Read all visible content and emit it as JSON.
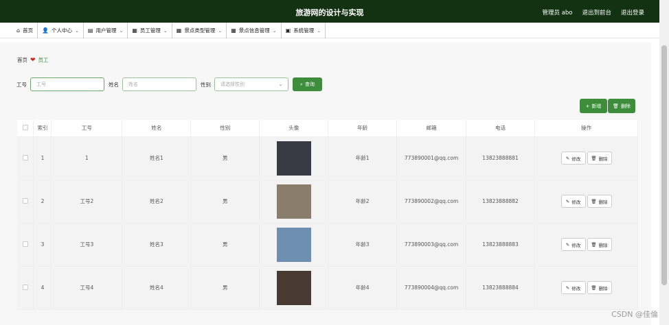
{
  "header": {
    "title": "旅游网的设计与实现",
    "admin": "管理员 abo",
    "exit_front": "退出到前台",
    "logout": "退出登录"
  },
  "nav": [
    {
      "icon": "home-icon",
      "glyph": "⌂",
      "label": "首页",
      "chevron": false
    },
    {
      "icon": "user-icon",
      "glyph": "👤",
      "label": "个人中心",
      "chevron": true
    },
    {
      "icon": "clipboard-icon",
      "glyph": "▤",
      "label": "用户管理",
      "chevron": true
    },
    {
      "icon": "grid-icon",
      "glyph": "▦",
      "label": "员工管理",
      "chevron": true
    },
    {
      "icon": "grid-icon",
      "glyph": "▦",
      "label": "景点类型管理",
      "chevron": true
    },
    {
      "icon": "grid-icon",
      "glyph": "▦",
      "label": "景点信息管理",
      "chevron": true
    },
    {
      "icon": "briefcase-icon",
      "glyph": "▣",
      "label": "系统管理",
      "chevron": true
    }
  ],
  "breadcrumb": {
    "home": "首页",
    "current": "员工"
  },
  "search": {
    "id_label": "工号",
    "id_placeholder": "工号",
    "name_label": "姓名",
    "name_placeholder": "姓名",
    "gender_label": "性别",
    "gender_placeholder": "请选择性别",
    "query_button": "查询"
  },
  "actions": {
    "add": "新增",
    "delete": "删除"
  },
  "table": {
    "columns": [
      "索引",
      "工号",
      "姓名",
      "性别",
      "头像",
      "年龄",
      "邮箱",
      "电话",
      "操作"
    ],
    "rows": [
      {
        "index": "1",
        "id": "1",
        "name": "姓名1",
        "gender": "男",
        "age": "年龄1",
        "email": "773890001@qq.com",
        "phone": "13823888881",
        "avatar_color": "#3a3a44"
      },
      {
        "index": "2",
        "id": "工号2",
        "name": "姓名2",
        "gender": "男",
        "age": "年龄2",
        "email": "773890002@qq.com",
        "phone": "13823888882",
        "avatar_color": "#8a7d6c"
      },
      {
        "index": "3",
        "id": "工号3",
        "name": "姓名3",
        "gender": "男",
        "age": "年龄3",
        "email": "773890003@qq.com",
        "phone": "13823888883",
        "avatar_color": "#6e8fb0"
      },
      {
        "index": "4",
        "id": "工号4",
        "name": "姓名4",
        "gender": "男",
        "age": "年龄4",
        "email": "773890004@qq.com",
        "phone": "13823888884",
        "avatar_color": "#4a3a34"
      }
    ],
    "edit_label": "修改",
    "delete_label": "删除"
  },
  "watermark": "CSDN @佳倫",
  "colors": {
    "header_bg": "#123212",
    "accent": "#3d8d3d"
  }
}
